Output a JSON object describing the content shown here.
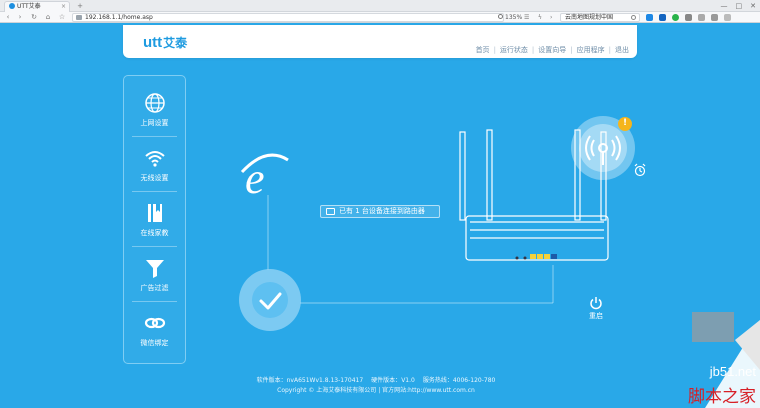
{
  "browser": {
    "tab_title": "UTT艾泰",
    "url": "192.168.1.1/home.asp",
    "zoom": "135%",
    "search_text": "云南地图规划中国"
  },
  "header": {
    "logo_text": "utt",
    "logo_cn": "艾泰",
    "nav": [
      "首页",
      "运行状态",
      "设置向导",
      "应用程序",
      "退出"
    ]
  },
  "sidebar": {
    "items": [
      {
        "label": "上网设置",
        "icon": "globe-icon"
      },
      {
        "label": "无线设置",
        "icon": "wifi-icon"
      },
      {
        "label": "在线家教",
        "icon": "book-icon"
      },
      {
        "label": "广告过滤",
        "icon": "filter-funnel-icon"
      },
      {
        "label": "微信绑定",
        "icon": "chain-link-icon"
      }
    ]
  },
  "main": {
    "status_text": "已有 1 台设备连接到路由器",
    "reboot_label": "重启",
    "alert_badge": "!"
  },
  "footer": {
    "line1_software_label": "软件版本：",
    "software_version": "nvA651Wv1.8.13-170417",
    "line1_hardware_label": "硬件版本：",
    "hardware_version": "V1.0",
    "line1_hotline_label": "服务热线：",
    "hotline": "4006-120-780",
    "line2_copyright": "Copyright © 上海艾泰科技有限公司",
    "line2_site_label": "官方网站:",
    "site_url": "http://www.utt.com.cn"
  },
  "watermark": {
    "site": "jb51.net",
    "name": "脚本之家"
  },
  "colors": {
    "background": "#29a8e8",
    "accent": "#1e9be0",
    "alert": "#f5b51c"
  }
}
